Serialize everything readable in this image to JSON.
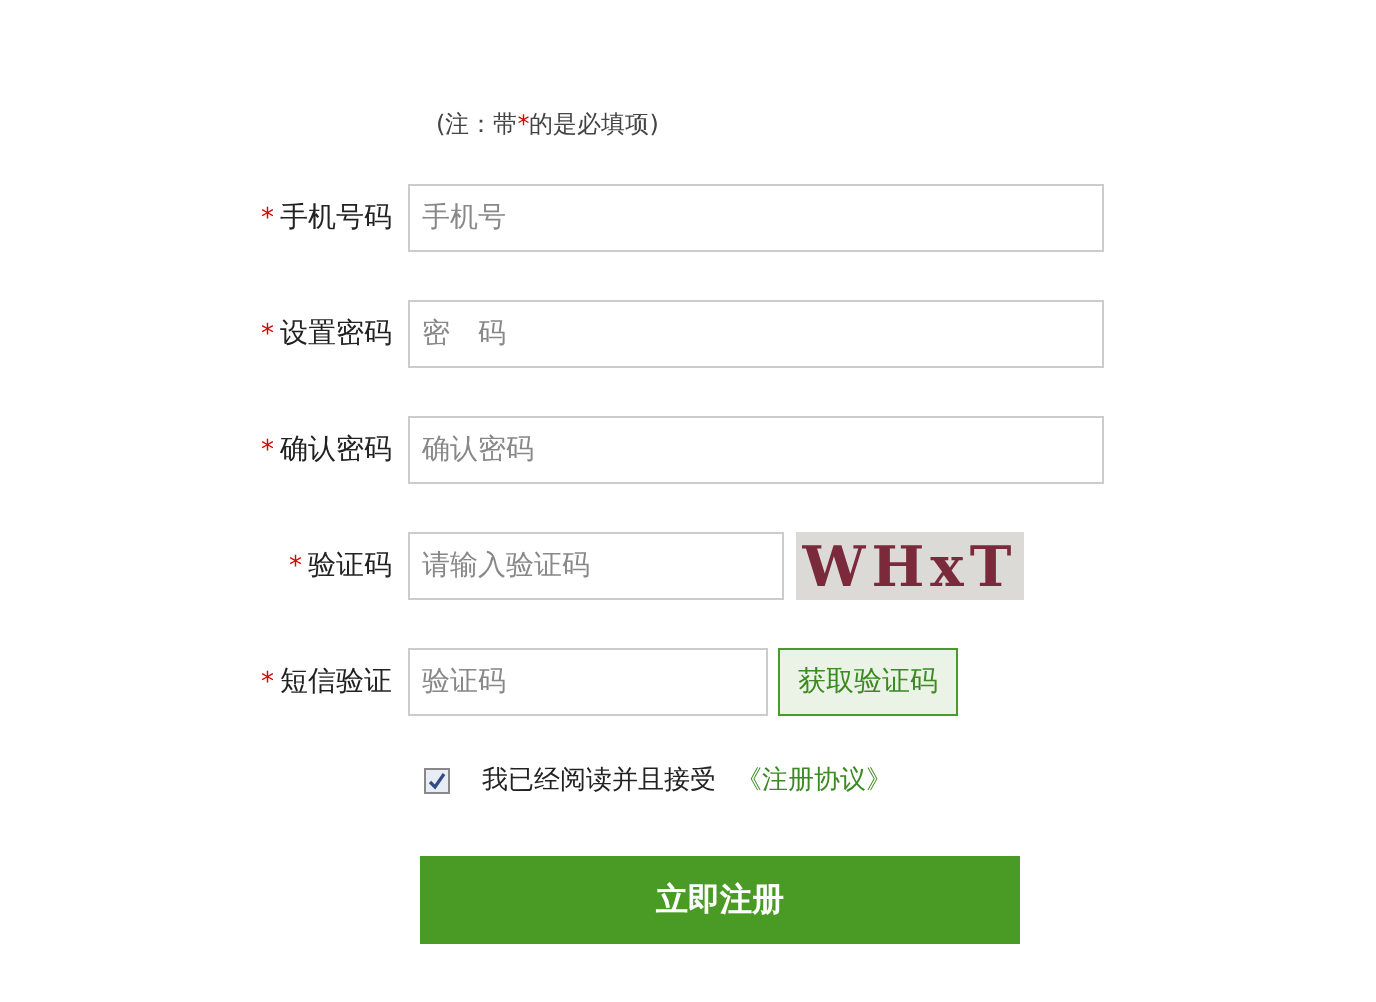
{
  "note": {
    "before": "(注：带",
    "mark": "*",
    "after": "的是必填项)"
  },
  "fields": [
    {
      "kind": "input",
      "star": "*",
      "label": "手机号码",
      "placeholder": "手机号"
    },
    {
      "kind": "input",
      "star": "*",
      "label": "设置密码",
      "placeholder": "密　码"
    },
    {
      "kind": "input",
      "star": "*",
      "label": "确认密码",
      "placeholder": "确认密码"
    },
    {
      "kind": "captcha",
      "star": "*",
      "label": "验证码",
      "placeholder": "请输入验证码",
      "captcha_text": "WHxT"
    },
    {
      "kind": "sms",
      "star": "*",
      "label": "短信验证",
      "placeholder": "验证码",
      "button": "获取验证码"
    }
  ],
  "agreement": {
    "checked": true,
    "text": "我已经阅读并且接受",
    "link": "《注册协议》"
  },
  "submit": "立即注册"
}
